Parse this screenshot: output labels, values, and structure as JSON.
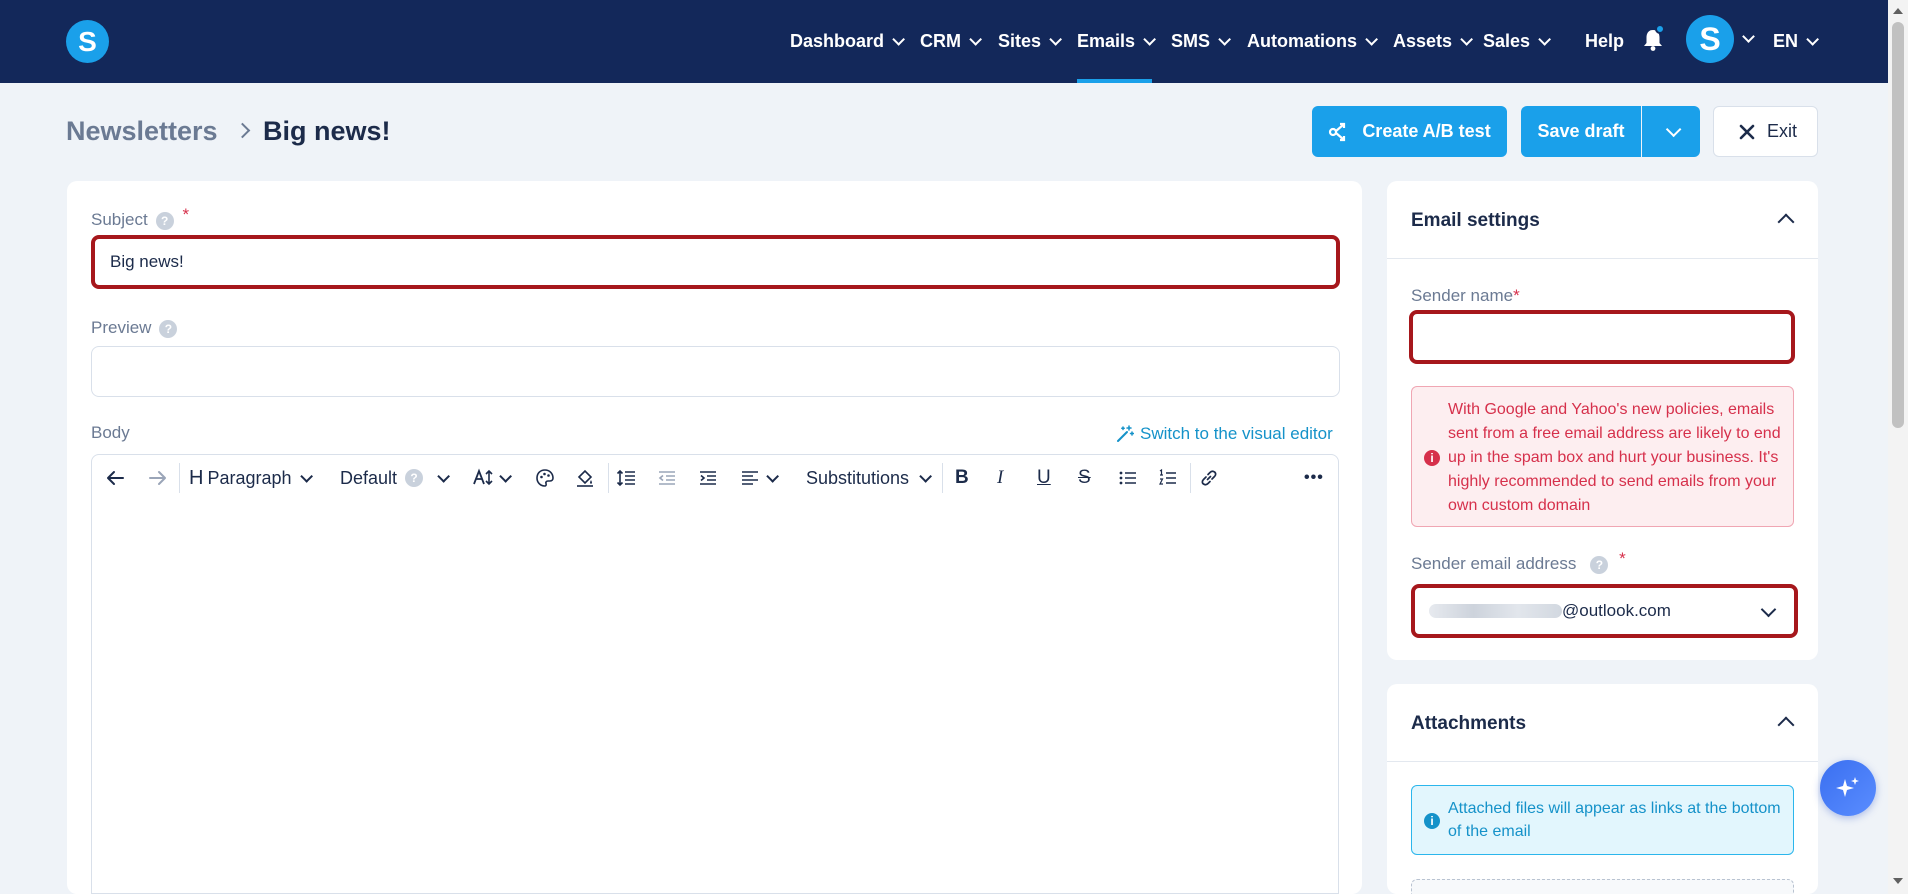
{
  "nav": {
    "items": [
      {
        "label": "Dashboard"
      },
      {
        "label": "CRM"
      },
      {
        "label": "Sites"
      },
      {
        "label": "Emails"
      },
      {
        "label": "SMS"
      },
      {
        "label": "Automations"
      },
      {
        "label": "Assets"
      },
      {
        "label": "Sales"
      }
    ],
    "active": "Emails",
    "help": "Help",
    "logo_letter": "S",
    "avatar_letter": "S",
    "language": "EN"
  },
  "breadcrumb": {
    "parent": "Newsletters",
    "current": "Big news!"
  },
  "actions": {
    "ab_test": "Create A/B test",
    "save_draft": "Save draft",
    "exit": "Exit"
  },
  "form": {
    "subject_label": "Subject",
    "subject_value": "Big news!",
    "preview_label": "Preview",
    "preview_value": "",
    "body_label": "Body",
    "switch_editor": "Switch to the visual editor",
    "required_mark": "*",
    "help_mark": "?"
  },
  "toolbar": {
    "heading_icon": "H",
    "block_format": "Paragraph",
    "font": "Default",
    "substitutions": "Substitutions",
    "bold": "B",
    "italic": "I",
    "underline": "U",
    "strike": "S",
    "more": "•••"
  },
  "email_settings": {
    "title": "Email settings",
    "sender_name_label": "Sender name",
    "sender_name_value": "",
    "warning": "With Google and Yahoo's new policies, emails sent from a free email address are likely to end up in the spam box and hurt your business. It's highly recommended to send emails from your own custom domain",
    "sender_email_label": "Sender email address",
    "sender_email_domain": "@outlook.com"
  },
  "attachments": {
    "title": "Attachments",
    "info": "Attached files will appear as links at the bottom of the email"
  },
  "colors": {
    "nav_bg": "#13285a",
    "accent": "#1aa0ea",
    "error": "#a6171c",
    "page_bg": "#eff3f8"
  }
}
